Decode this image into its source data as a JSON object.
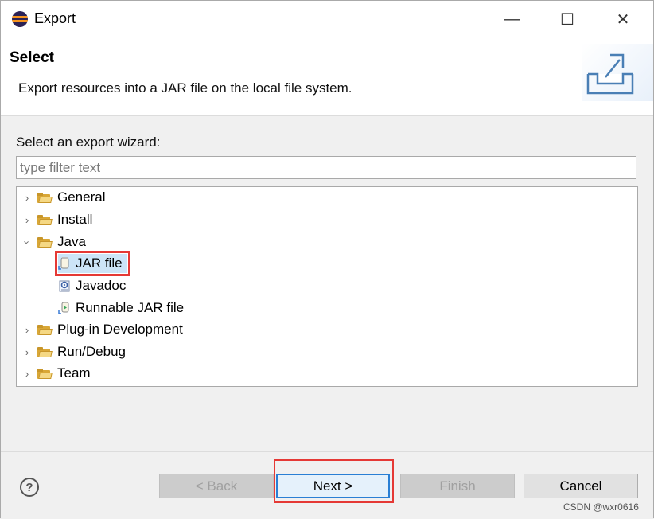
{
  "window": {
    "title": "Export",
    "minimize_glyph": "—",
    "maximize_glyph": "☐",
    "close_glyph": "✕"
  },
  "header": {
    "title": "Select",
    "description": "Export resources into a JAR file on the local file system."
  },
  "wizard": {
    "label": "Select an export wizard:",
    "filter_placeholder": "type filter text",
    "filter_value": ""
  },
  "tree": {
    "items": [
      {
        "label": "General",
        "expanded": false,
        "icon": "folder-icon"
      },
      {
        "label": "Install",
        "expanded": false,
        "icon": "folder-icon"
      },
      {
        "label": "Java",
        "expanded": true,
        "icon": "folder-icon",
        "children": [
          {
            "label": "JAR file",
            "icon": "jar-file-icon",
            "selected": true
          },
          {
            "label": "Javadoc",
            "icon": "javadoc-icon"
          },
          {
            "label": "Runnable JAR file",
            "icon": "runnable-jar-icon"
          }
        ]
      },
      {
        "label": "Plug-in Development",
        "expanded": false,
        "icon": "folder-icon"
      },
      {
        "label": "Run/Debug",
        "expanded": false,
        "icon": "folder-icon"
      },
      {
        "label": "Team",
        "expanded": false,
        "icon": "folder-icon"
      }
    ]
  },
  "buttons": {
    "help": "?",
    "back": "< Back",
    "next": "Next >",
    "finish": "Finish",
    "cancel": "Cancel"
  },
  "watermark": "CSDN @wxr0616",
  "colors": {
    "selection": "#cce4f7",
    "highlight": "#e53935",
    "primary_border": "#2a7fd4"
  }
}
